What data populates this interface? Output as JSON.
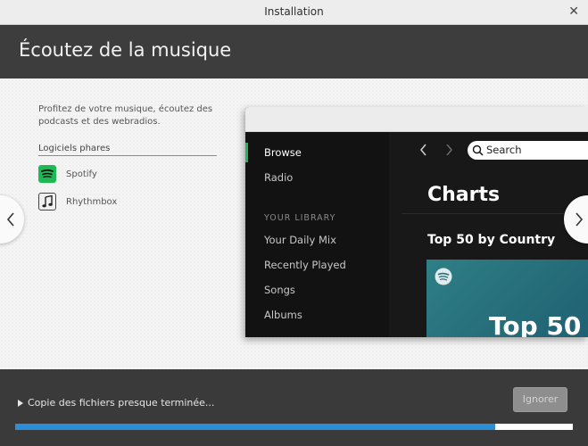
{
  "window": {
    "title": "Installation"
  },
  "header": {
    "title": "Écoutez de la musique"
  },
  "left_panel": {
    "description": "Profitez de votre musique, écoutez des podcasts et des webradios.",
    "section_title": "Logiciels phares",
    "apps": [
      {
        "name": "Spotify",
        "icon": "spotify-icon",
        "color": "#1db954"
      },
      {
        "name": "Rhythmbox",
        "icon": "rhythmbox-icon"
      }
    ]
  },
  "preview": {
    "sidebar": {
      "items": [
        "Browse",
        "Radio"
      ],
      "active": "Browse",
      "library_title": "YOUR LIBRARY",
      "library_items": [
        "Your Daily Mix",
        "Recently Played",
        "Songs",
        "Albums"
      ]
    },
    "search_placeholder": "Search",
    "page_title": "Charts",
    "section_title": "Top 50 by Country",
    "card_text": "Top 50"
  },
  "footer": {
    "status": "Copie des fichiers presque terminée...",
    "skip_label": "Ignorer",
    "progress": 0.86
  },
  "colors": {
    "accent": "#2b8ed6",
    "spotify_green": "#1db954"
  }
}
